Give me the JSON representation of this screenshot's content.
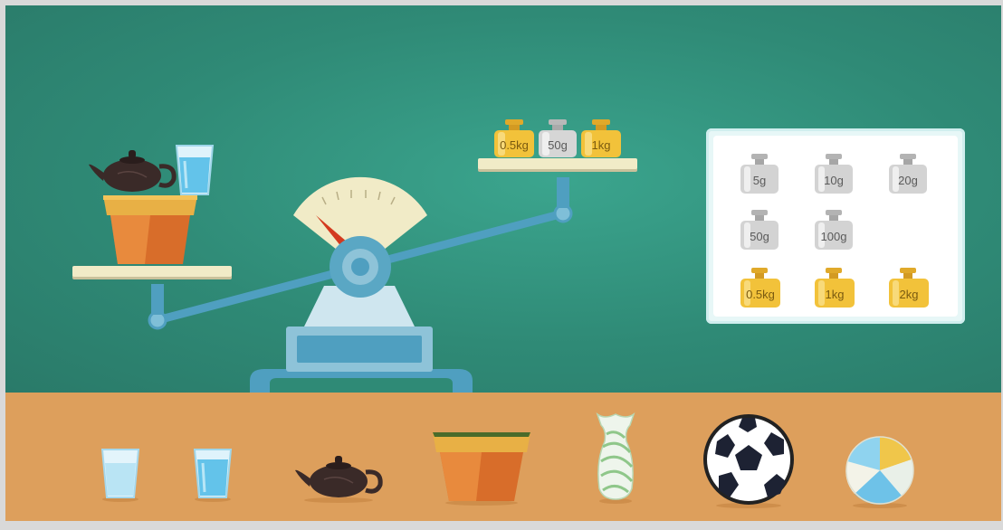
{
  "pan_right_weights": [
    {
      "label": "0.5kg",
      "color": "gold"
    },
    {
      "label": "50g",
      "color": "silver"
    },
    {
      "label": "1kg",
      "color": "gold"
    }
  ],
  "weight_panel": [
    {
      "label": "5g",
      "color": "silver"
    },
    {
      "label": "10g",
      "color": "silver"
    },
    {
      "label": "20g",
      "color": "silver"
    },
    {
      "label": "50g",
      "color": "silver"
    },
    {
      "label": "100g",
      "color": "silver"
    },
    {
      "label": "0.5kg",
      "color": "gold"
    },
    {
      "label": "1kg",
      "color": "gold"
    },
    {
      "label": "2kg",
      "color": "gold"
    }
  ],
  "pan_left_items": [
    "teapot-icon",
    "water-glass-icon",
    "flower-pot-icon"
  ],
  "shelf_items": [
    "water-glass-icon",
    "water-glass-icon",
    "teapot-icon",
    "flower-pot-icon",
    "striped-vase-icon",
    "soccer-ball-icon",
    "beach-ball-icon"
  ],
  "colors": {
    "board": "#2f8a76",
    "floor": "#dd9f5c",
    "scale_blue": "#5aa7c4",
    "gold": "#f2c23a",
    "silver": "#cfcfcf"
  }
}
